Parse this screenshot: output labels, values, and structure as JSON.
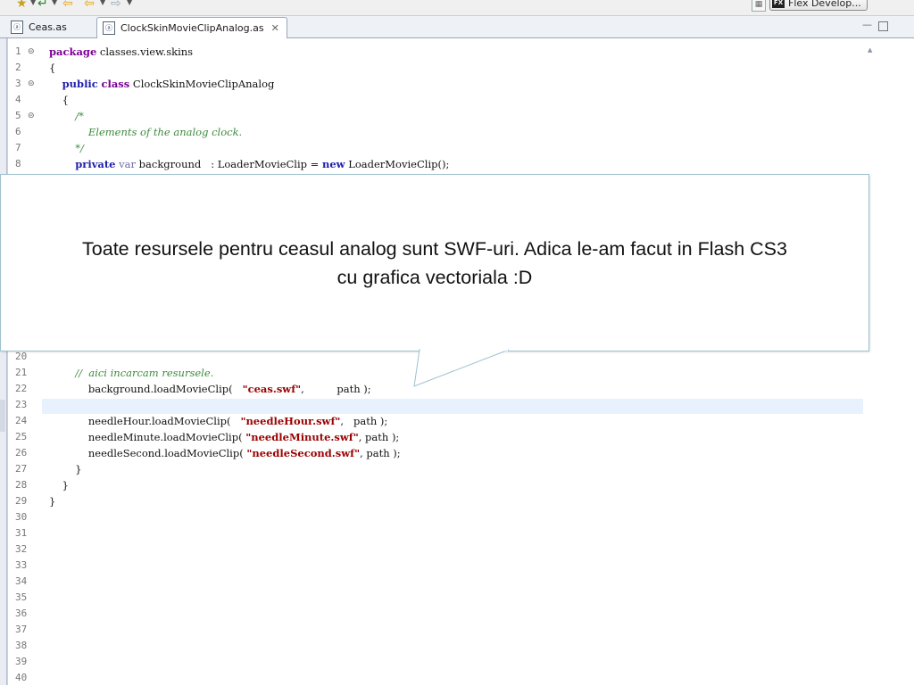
{
  "toolbar": {
    "icons": [
      "favorites-icon",
      "back-icon",
      "prev-edit-icon",
      "next-edit-icon",
      "forward-icon"
    ],
    "perspective_label": "Flex Develop..."
  },
  "tabs": [
    {
      "label": "Ceas.as",
      "active": false
    },
    {
      "label": "ClockSkinMovieClipAnalog.as",
      "active": true
    }
  ],
  "editor": {
    "lines": [
      {
        "n": "1",
        "fold": true,
        "parts": [
          [
            "kw",
            "package"
          ],
          [
            "p",
            " classes.view.skins"
          ]
        ]
      },
      {
        "n": "2",
        "fold": false,
        "parts": [
          [
            "p",
            "{"
          ]
        ]
      },
      {
        "n": "3",
        "fold": true,
        "parts": [
          [
            "p",
            "    "
          ],
          [
            "kw2",
            "public"
          ],
          [
            "p",
            " "
          ],
          [
            "kw",
            "class"
          ],
          [
            "p",
            " ClockSkinMovieClipAnalog"
          ]
        ]
      },
      {
        "n": "4",
        "fold": false,
        "parts": [
          [
            "p",
            "    {"
          ]
        ]
      },
      {
        "n": "5",
        "fold": true,
        "parts": [
          [
            "cm",
            "        /*"
          ]
        ]
      },
      {
        "n": "6",
        "fold": false,
        "parts": [
          [
            "cm",
            "            Elements of the analog clock."
          ]
        ]
      },
      {
        "n": "7",
        "fold": false,
        "parts": [
          [
            "cm",
            "        */"
          ]
        ]
      },
      {
        "n": "8",
        "fold": false,
        "parts": [
          [
            "p",
            "        "
          ],
          [
            "kw2",
            "private"
          ],
          [
            "p",
            " "
          ],
          [
            "kwv",
            "var"
          ],
          [
            "p",
            " background   : LoaderMovieClip = "
          ],
          [
            "kw2",
            "new"
          ],
          [
            "p",
            " LoaderMovieClip();"
          ]
        ]
      },
      {
        "n": "20",
        "fold": false,
        "parts": []
      },
      {
        "n": "21",
        "fold": false,
        "parts": [
          [
            "cm",
            "        //  aici incarcam resursele."
          ]
        ]
      },
      {
        "n": "22",
        "fold": false,
        "parts": [
          [
            "p",
            "            background.loadMovieClip(   "
          ],
          [
            "str",
            "\"ceas.swf\""
          ],
          [
            "p",
            ",          path );"
          ]
        ]
      },
      {
        "n": "23",
        "fold": false,
        "parts": []
      },
      {
        "n": "24",
        "fold": false,
        "parts": [
          [
            "p",
            "            needleHour.loadMovieClip(   "
          ],
          [
            "str",
            "\"needleHour.swf\""
          ],
          [
            "p",
            ",   path );"
          ]
        ]
      },
      {
        "n": "25",
        "fold": false,
        "parts": [
          [
            "p",
            "            needleMinute.loadMovieClip( "
          ],
          [
            "str",
            "\"needleMinute.swf\""
          ],
          [
            "p",
            ", path );"
          ]
        ]
      },
      {
        "n": "26",
        "fold": false,
        "parts": [
          [
            "p",
            "            needleSecond.loadMovieClip( "
          ],
          [
            "str",
            "\"needleSecond.swf\""
          ],
          [
            "p",
            ", path );"
          ]
        ]
      },
      {
        "n": "27",
        "fold": false,
        "parts": [
          [
            "p",
            "        }"
          ]
        ]
      },
      {
        "n": "28",
        "fold": false,
        "parts": [
          [
            "p",
            "    }"
          ]
        ]
      },
      {
        "n": "29",
        "fold": false,
        "parts": [
          [
            "p",
            "}"
          ]
        ]
      },
      {
        "n": "30",
        "fold": false,
        "parts": []
      },
      {
        "n": "31",
        "fold": false,
        "parts": []
      },
      {
        "n": "32",
        "fold": false,
        "parts": []
      },
      {
        "n": "33",
        "fold": false,
        "parts": []
      },
      {
        "n": "34",
        "fold": false,
        "parts": []
      },
      {
        "n": "35",
        "fold": false,
        "parts": []
      },
      {
        "n": "36",
        "fold": false,
        "parts": []
      },
      {
        "n": "37",
        "fold": false,
        "parts": []
      },
      {
        "n": "38",
        "fold": false,
        "parts": []
      },
      {
        "n": "39",
        "fold": false,
        "parts": []
      },
      {
        "n": "40",
        "fold": false,
        "parts": []
      }
    ]
  },
  "callout": {
    "line1": "Toate resursele pentru ceasul analog sunt SWF-uri. Adica le-am facut in Flash CS3",
    "line2": "cu grafica vectoriala :D"
  }
}
